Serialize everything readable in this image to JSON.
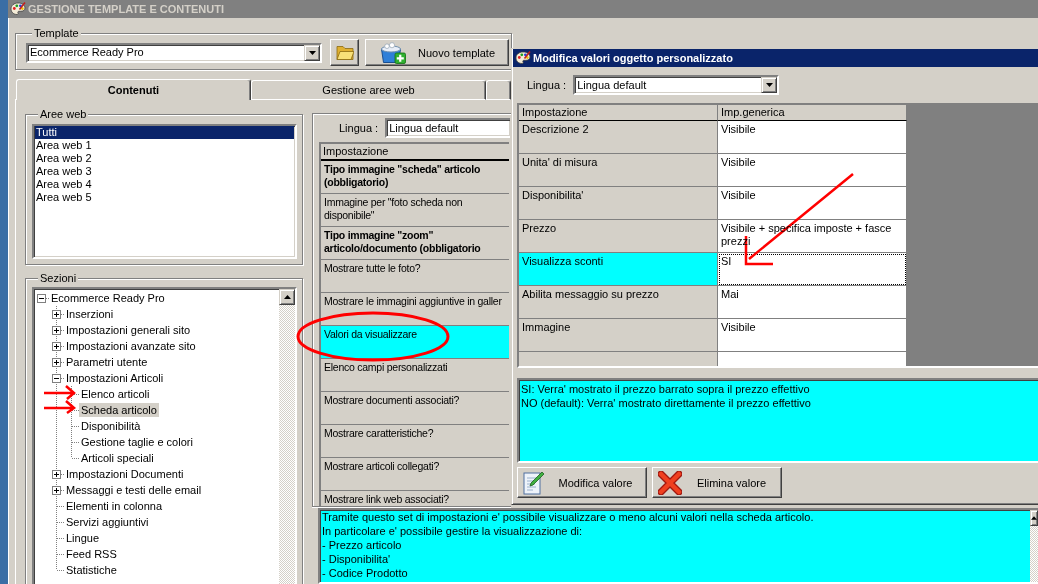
{
  "main_window": {
    "title": "GESTIONE TEMPLATE E CONTENUTI",
    "active": false
  },
  "template": {
    "label": "Template",
    "value": "Ecommerce Ready Pro",
    "new_button": "Nuovo template"
  },
  "tabs": [
    {
      "label": "Contenuti",
      "selected": true
    },
    {
      "label": "Gestione aree web",
      "selected": false
    }
  ],
  "aree_web": {
    "label": "Aree web",
    "items": [
      {
        "label": "Tutti",
        "selected": true
      },
      {
        "label": "Area web 1",
        "selected": false
      },
      {
        "label": "Area web 2",
        "selected": false
      },
      {
        "label": "Area web 3",
        "selected": false
      },
      {
        "label": "Area web 4",
        "selected": false
      },
      {
        "label": "Area web 5",
        "selected": false
      }
    ]
  },
  "sezioni": {
    "label": "Sezioni",
    "tree": [
      {
        "label": "Ecommerce Ready Pro",
        "selected": false,
        "expanded": true,
        "children": [
          {
            "label": "Inserzioni",
            "selected": false,
            "expanded": false
          },
          {
            "label": "Impostazioni generali sito",
            "selected": false,
            "expanded": false
          },
          {
            "label": "Impostazioni avanzate sito",
            "selected": false,
            "expanded": false
          },
          {
            "label": "Parametri utente",
            "selected": false,
            "expanded": false
          },
          {
            "label": "Impostazioni Articoli",
            "selected": false,
            "expanded": true,
            "children": [
              {
                "label": "Elenco articoli",
                "selected": false
              },
              {
                "label": "Scheda articolo",
                "selected": true
              },
              {
                "label": "Disponibilità",
                "selected": false
              },
              {
                "label": "Gestione taglie e colori",
                "selected": false
              },
              {
                "label": "Articoli speciali",
                "selected": false
              }
            ]
          },
          {
            "label": "Impostazioni Documenti",
            "selected": false,
            "expanded": false
          },
          {
            "label": "Messaggi e testi delle email",
            "selected": false,
            "expanded": false
          },
          {
            "label": "Elementi in colonna",
            "selected": false
          },
          {
            "label": "Servizi aggiuntivi",
            "selected": false
          },
          {
            "label": "Lingue",
            "selected": false
          },
          {
            "label": "Feed RSS",
            "selected": false
          },
          {
            "label": "Statistiche",
            "selected": false
          }
        ]
      }
    ]
  },
  "settings_panel": {
    "language_label": "Lingua :",
    "language": "Lingua default",
    "column": "Impostazione",
    "rows": [
      {
        "setting": "Tipo immagine \"scheda\" articolo (obbligatorio)",
        "bold": true,
        "selected": false
      },
      {
        "setting": "Immagine per \"foto scheda non disponibile\"",
        "bold": false,
        "selected": false
      },
      {
        "setting": "Tipo immagine \"zoom\" articolo/documento (obbligatorio",
        "bold": true,
        "selected": false
      },
      {
        "setting": "Mostrare tutte le foto?",
        "bold": false,
        "selected": false
      },
      {
        "setting": "Mostrare le immagini aggiuntive in galler",
        "bold": false,
        "selected": false
      },
      {
        "setting": "Valori da visualizzare",
        "bold": false,
        "selected": true
      },
      {
        "setting": "Elenco campi personalizzati",
        "bold": false,
        "selected": false
      },
      {
        "setting": "Mostrare documenti associati?",
        "bold": false,
        "selected": false
      },
      {
        "setting": "Mostrare caratteristiche?",
        "bold": false,
        "selected": false
      },
      {
        "setting": "Mostrare articoli collegati?",
        "bold": false,
        "selected": false
      },
      {
        "setting": "Mostrare link web associati?",
        "bold": false,
        "selected": false
      }
    ]
  },
  "description": {
    "lines": [
      "Tramite questo set di impostazioni e' possibile visualizzare o meno alcuni valori nella scheda articolo.",
      "In particolare e' possibile gestire la visualizzazione di:",
      "- Prezzo articolo",
      "- Disponibilita'",
      "- Codice Prodotto"
    ]
  },
  "dialog": {
    "title": "Modifica valori oggetto personalizzato",
    "active": true,
    "language_label": "Lingua :",
    "language": "Lingua default",
    "columns": [
      "Impostazione",
      "Imp.generica"
    ],
    "rows": [
      {
        "setting": "Descrizione 2",
        "value": "Visibile",
        "selected": false
      },
      {
        "setting": "Unita' di misura",
        "value": "Visibile",
        "selected": false
      },
      {
        "setting": "Disponibilita'",
        "value": "Visibile",
        "selected": false
      },
      {
        "setting": "Prezzo",
        "value": "Visibile + specifica imposte + fasce prezzi",
        "selected": false
      },
      {
        "setting": "Visualizza sconti",
        "value": "SI",
        "selected": true
      },
      {
        "setting": "Abilita messaggio su prezzo",
        "value": "Mai",
        "selected": false
      },
      {
        "setting": "Immagine",
        "value": "Visibile",
        "selected": false
      }
    ],
    "help": {
      "lines": [
        "SI: Verra' mostrato il prezzo barrato sopra il prezzo effettivo",
        "NO (default): Verra' mostrato direttamente il prezzo effettivo"
      ]
    },
    "buttons": [
      {
        "label": "Modifica valore",
        "kind": "edit"
      },
      {
        "label": "Elimina valore",
        "kind": "delete"
      }
    ]
  }
}
